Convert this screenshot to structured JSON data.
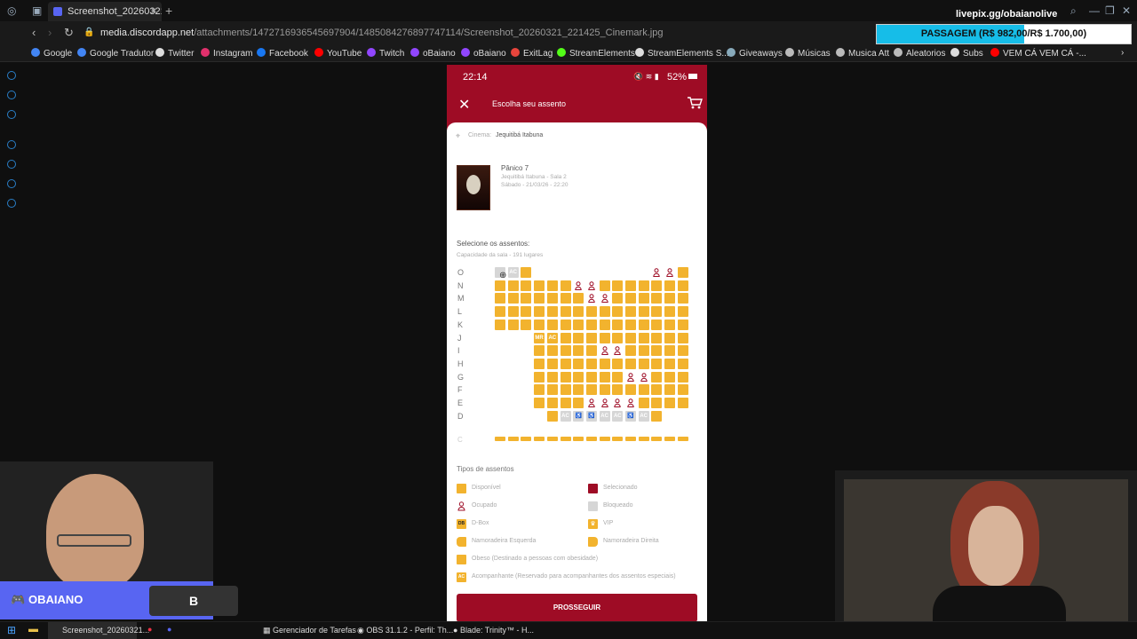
{
  "browser": {
    "tab_title": "Screenshot_20260321_22",
    "url_host": "media.discordapp.net",
    "url_path": "/attachments/1472716936545697904/1485084276897747114/Screenshot_20260321_221425_Cinemark.jpg",
    "bookmarks": [
      "Google",
      "Google Tradutor",
      "Twitter",
      "Instagram",
      "Facebook",
      "YouTube",
      "Twitch",
      "oBaiano",
      "oBaiano",
      "ExitLag",
      "StreamElements",
      "StreamElements S...",
      "Giveaways",
      "Músicas",
      "Musica Att",
      "Aleatorios",
      "Subs",
      "VEM CÁ VEM CÁ -..."
    ]
  },
  "overlay": {
    "livepix": "livepix.gg/obaianolive",
    "goal_text": "PASSAGEM (R$ 982,00/R$ 1.700,00)",
    "goal_progress": 0.58,
    "discord_name": "OBAIANO",
    "discord_letter": "B"
  },
  "phone": {
    "time": "22:14",
    "battery": "52%",
    "header_title": "Escolha seu assento",
    "cinema_label": "Cinema:",
    "cinema_name": "Jequitibá Itabuna",
    "movie_title": "Pânico 7",
    "movie_room": "Jequitibá Itabuna - Sala 2",
    "movie_date": "Sábado - 21/03/26 - 22:20",
    "select_title": "Selecione os assentos:",
    "capacity": "Capacidade da sala - 191 lugares",
    "rows": [
      "O",
      "N",
      "M",
      "L",
      "K",
      "J",
      "I",
      "H",
      "G",
      "F",
      "E",
      "D"
    ],
    "legend_title": "Tipos de assentos",
    "legend": {
      "disponivel": "Disponível",
      "selecionado": "Selecionado",
      "ocupado": "Ocupado",
      "bloqueado": "Bloqueado",
      "dbox": "D-Box",
      "vip": "VIP",
      "nam_esq": "Namoradeira Esquerda",
      "nam_dir": "Namoradeira Direita",
      "obeso": "Obeso (Destinado a pessoas com obesidade)",
      "acompanhante": "Acompanhante (Reservado para acompanhantes dos assentos especiais)"
    },
    "button": "PROSSEGUIR"
  },
  "taskbar": {
    "items": [
      "Screenshot_20260321...",
      "Gerenciador de Tarefas",
      "OBS 31.1.2 - Perfil: Th...",
      "Blade: Trinity™ - H..."
    ]
  },
  "colors": {
    "brand": "#9e0c25",
    "seat": "#f2b32e",
    "blocked": "#d6d6d6",
    "goal": "#16bde8"
  }
}
